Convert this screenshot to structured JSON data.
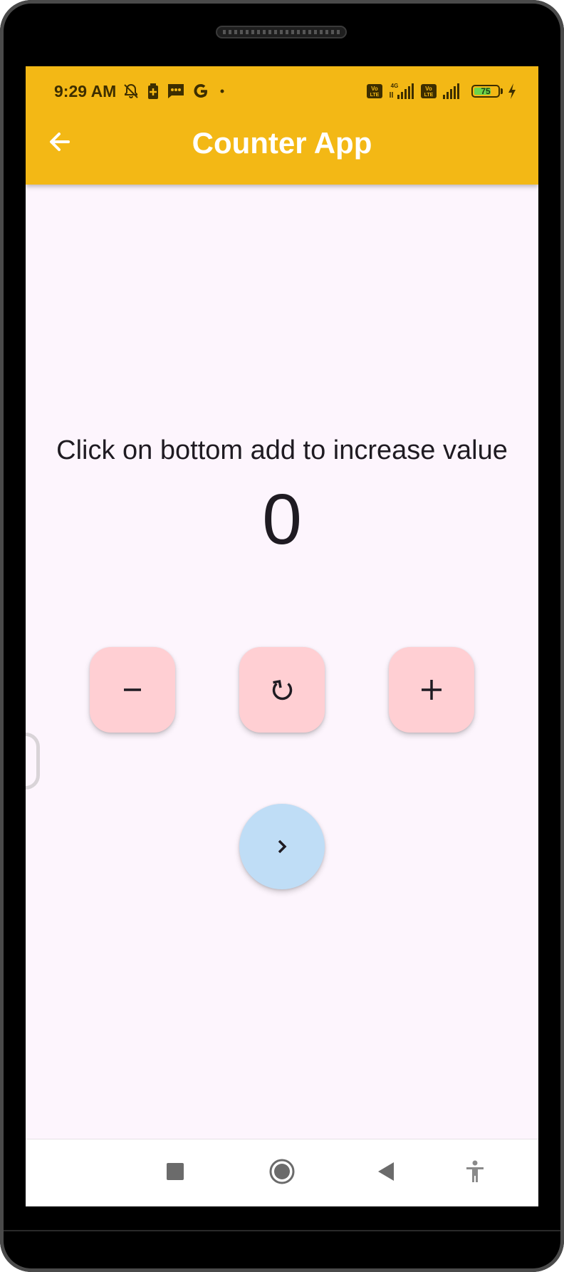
{
  "status_bar": {
    "time": "9:29 AM",
    "battery_level": "75",
    "battery_fraction": 0.75,
    "left_icons": [
      "bell-off-icon",
      "battery-saver-icon",
      "message-icon",
      "google-icon",
      "dot-icon"
    ],
    "right_icons": [
      "volte-icon",
      "signal-4g-icon",
      "volte-icon",
      "signal-icon",
      "battery-icon",
      "charging-icon"
    ],
    "network_label": "4G",
    "volte_label": "Vo LTE"
  },
  "app_bar": {
    "title": "Counter App",
    "back_icon": "arrow-left-icon",
    "background_color": "#f3b815",
    "title_color": "#ffffff"
  },
  "main": {
    "instruction": "Click on bottom add to increase value",
    "counter_value": "0",
    "buttons": {
      "decrement_icon": "minus-icon",
      "reset_icon": "refresh-icon",
      "increment_icon": "plus-icon",
      "next_icon": "chevron-right-icon"
    },
    "colors": {
      "background": "#fdf5fd",
      "square_button": "#ffcfd3",
      "round_button": "#bfddf6",
      "text": "#1f1b22"
    }
  },
  "nav_bar": {
    "items": [
      "recents-icon",
      "home-icon",
      "back-icon",
      "accessibility-icon"
    ]
  }
}
